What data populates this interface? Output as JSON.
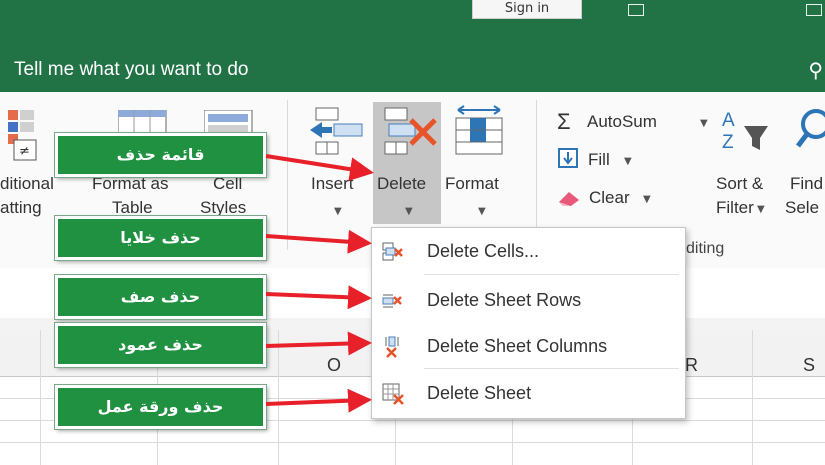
{
  "titlebar": {
    "signin_label": "Sign in"
  },
  "tellme": {
    "text": "Tell me what you want to do"
  },
  "ribbon": {
    "conditional_line1": "ditional",
    "conditional_line2": "atting",
    "format_table_line1": "Format as",
    "format_table_line2": "Table",
    "cell_styles_line1": "Cell",
    "cell_styles_line2": "Styles",
    "insert_label": "Insert",
    "delete_label": "Delete",
    "format_label": "Format",
    "autosum_label": "AutoSum",
    "fill_label": "Fill",
    "clear_label": "Clear",
    "sort_filter_line1": "Sort &",
    "sort_filter_line2": "Filter",
    "find_select_line1": "Find",
    "find_select_line2": "Sele",
    "editing_group": "diting",
    "styles_group_fragment": "y"
  },
  "menu": {
    "items": [
      {
        "label": "Delete Cells...",
        "icon": "delete-cells-icon"
      },
      {
        "label": "Delete Sheet Rows",
        "icon": "delete-rows-icon"
      },
      {
        "label": "Delete Sheet Columns",
        "icon": "delete-columns-icon"
      },
      {
        "label": "Delete Sheet",
        "icon": "delete-sheet-icon"
      }
    ]
  },
  "columns": [
    "O",
    "R",
    "S"
  ],
  "callouts": [
    {
      "text": "قائمة حذف"
    },
    {
      "text": "حذف خلايا"
    },
    {
      "text": "حذف صف"
    },
    {
      "text": "حذف عمود"
    },
    {
      "text": "حذف ورقة عمل"
    }
  ],
  "colors": {
    "excel_green": "#217346",
    "callout_green": "#1f9141",
    "arrow_red": "#e8202a",
    "delete_x": "#e8542a"
  }
}
